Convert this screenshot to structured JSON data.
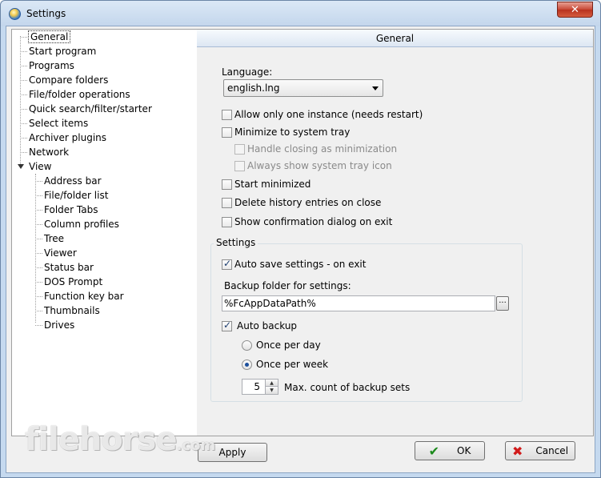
{
  "window": {
    "title": "Settings"
  },
  "tree": {
    "items": [
      {
        "label": "General",
        "level": 0,
        "selected": true
      },
      {
        "label": "Start program",
        "level": 0
      },
      {
        "label": "Programs",
        "level": 0
      },
      {
        "label": "Compare folders",
        "level": 0
      },
      {
        "label": "File/folder operations",
        "level": 0
      },
      {
        "label": "Quick search/filter/starter",
        "level": 0
      },
      {
        "label": "Select items",
        "level": 0
      },
      {
        "label": "Archiver plugins",
        "level": 0
      },
      {
        "label": "Network",
        "level": 0
      },
      {
        "label": "View",
        "level": 0,
        "expanded": true
      },
      {
        "label": "Address bar",
        "level": 1
      },
      {
        "label": "File/folder list",
        "level": 1
      },
      {
        "label": "Folder Tabs",
        "level": 1
      },
      {
        "label": "Column profiles",
        "level": 1
      },
      {
        "label": "Tree",
        "level": 1
      },
      {
        "label": "Viewer",
        "level": 1
      },
      {
        "label": "Status bar",
        "level": 1
      },
      {
        "label": "DOS Prompt",
        "level": 1
      },
      {
        "label": "Function key bar",
        "level": 1
      },
      {
        "label": "Thumbnails",
        "level": 1
      },
      {
        "label": "Drives",
        "level": 1
      }
    ]
  },
  "panel": {
    "header": "General",
    "language_label": "Language:",
    "language_value": "english.lng",
    "options": {
      "one_instance": {
        "label": "Allow only one instance (needs restart)",
        "checked": false
      },
      "minimize_tray": {
        "label": "Minimize to system tray",
        "checked": false
      },
      "handle_closing": {
        "label": "Handle closing as minimization",
        "checked": false,
        "disabled": true
      },
      "always_tray_icon": {
        "label": "Always show system tray icon",
        "checked": false,
        "disabled": true
      },
      "start_minimized": {
        "label": "Start minimized",
        "checked": false
      },
      "delete_history": {
        "label": "Delete history entries on close",
        "checked": false
      },
      "confirm_exit": {
        "label": "Show confirmation dialog on exit",
        "checked": false
      }
    },
    "settings_group": {
      "title": "Settings",
      "auto_save": {
        "label": "Auto save settings - on exit",
        "checked": true
      },
      "backup_folder_label": "Backup folder for settings:",
      "backup_folder_value": "%FcAppDataPath%",
      "browse_label": "...",
      "auto_backup": {
        "label": "Auto backup",
        "checked": true
      },
      "once_per_day": {
        "label": "Once per day",
        "selected": false
      },
      "once_per_week": {
        "label": "Once per week",
        "selected": true
      },
      "max_count_value": "5",
      "max_count_label": "Max. count of backup sets"
    }
  },
  "buttons": {
    "apply": "Apply",
    "ok": "OK",
    "cancel": "Cancel"
  },
  "watermark": {
    "text": "filehorse",
    "suffix": ".com"
  }
}
